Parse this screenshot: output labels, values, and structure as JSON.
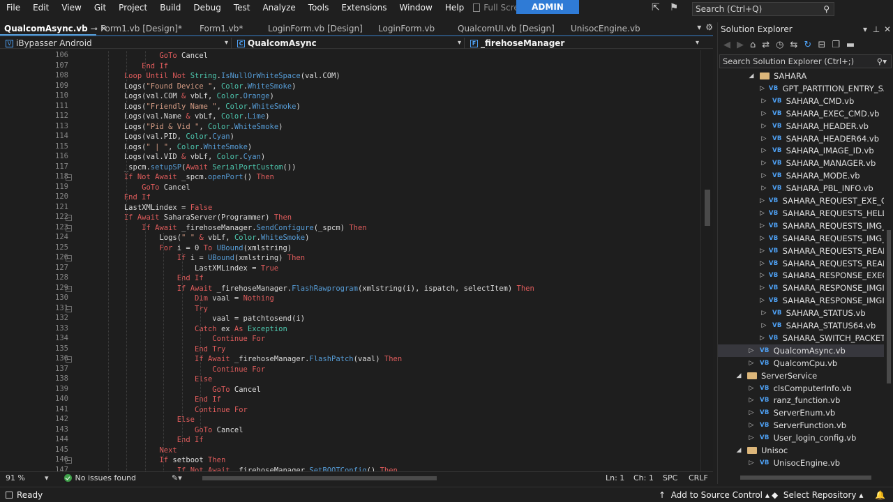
{
  "menu": [
    "File",
    "Edit",
    "View",
    "Git",
    "Project",
    "Build",
    "Debug",
    "Test",
    "Analyze",
    "Tools",
    "Extensions",
    "Window",
    "Help"
  ],
  "fullscreen_label": "Full Screen",
  "admin_label": "ADMIN",
  "search_placeholder": "Search (Ctrl+Q)",
  "tabs": [
    {
      "label": "QualcomAsync.vb",
      "active": true
    },
    {
      "label": "Form1.vb [Design]*"
    },
    {
      "label": "Form1.vb*"
    },
    {
      "label": "LoginForm.vb [Design]"
    },
    {
      "label": "LoginForm.vb"
    },
    {
      "label": "QualcomUI.vb [Design]"
    },
    {
      "label": "UnisocEngine.vb"
    }
  ],
  "nav": {
    "project": "iBypasser Android",
    "class": "QualcomAsync",
    "member": "_firehoseManager"
  },
  "code": {
    "first_line": 106,
    "lines": [
      "                    GoTo Cancel",
      "                End If",
      "            Loop Until Not String.IsNullOrWhiteSpace(val.COM)",
      "            Logs(\"Found Device \", Color.WhiteSmoke)",
      "            Logs(val.COM & vbLf, Color.Orange)",
      "            Logs(\"Friendly Name \", Color.WhiteSmoke)",
      "            Logs(val.Name & vbLf, Color.Lime)",
      "            Logs(\"Pid & Vid \", Color.WhiteSmoke)",
      "            Logs(val.PID, Color.Cyan)",
      "            Logs(\" | \", Color.WhiteSmoke)",
      "            Logs(val.VID & vbLf, Color.Cyan)",
      "            _spcm.setupSP(Await SerialPortCustom())",
      "            If Not Await _spcm.openPort() Then",
      "                GoTo Cancel",
      "            End If",
      "            LastXMLindex = False",
      "            If Await SaharaServer(Programmer) Then",
      "                If Await _firehoseManager.SendConfigure(_spcm) Then",
      "                    Logs(\" \" & vbLf, Color.WhiteSmoke)",
      "                    For i = 0 To UBound(xmlstring)",
      "                        If i = UBound(xmlstring) Then",
      "                            LastXMLindex = True",
      "                        End If",
      "                        If Await _firehoseManager.FlashRawprogram(xmlstring(i), ispatch, selectItem) Then",
      "                            Dim vaal = Nothing",
      "                            Try",
      "                                vaal = patchtosend(i)",
      "                            Catch ex As Exception",
      "                                Continue For",
      "                            End Try",
      "                            If Await _firehoseManager.FlashPatch(vaal) Then",
      "                                Continue For",
      "                            Else",
      "                                GoTo Cancel",
      "                            End If",
      "                            Continue For",
      "                        Else",
      "                            GoTo Cancel",
      "                        End If",
      "                    Next",
      "                    If setboot Then",
      "                        If Not Await _firehoseManager.SetBOOTConfig() Then"
    ]
  },
  "editor_status": {
    "zoom": "91 %",
    "issues": "No issues found",
    "line": "Ln: 1",
    "col": "Ch: 1",
    "spc": "SPC",
    "crlf": "CRLF"
  },
  "solution_explorer": {
    "title": "Solution Explorer",
    "search_placeholder": "Search Solution Explorer (Ctrl+;)",
    "items": [
      {
        "label": "SAHARA",
        "type": "folder",
        "level": 2,
        "expanded": true
      },
      {
        "label": "GPT_PARTITION_ENTRY_SA",
        "type": "vb",
        "level": 3
      },
      {
        "label": "SAHARA_CMD.vb",
        "type": "vb",
        "level": 3
      },
      {
        "label": "SAHARA_EXEC_CMD.vb",
        "type": "vb",
        "level": 3
      },
      {
        "label": "SAHARA_HEADER.vb",
        "type": "vb",
        "level": 3
      },
      {
        "label": "SAHARA_HEADER64.vb",
        "type": "vb",
        "level": 3
      },
      {
        "label": "SAHARA_IMAGE_ID.vb",
        "type": "vb",
        "level": 3
      },
      {
        "label": "SAHARA_MANAGER.vb",
        "type": "vb",
        "level": 3
      },
      {
        "label": "SAHARA_MODE.vb",
        "type": "vb",
        "level": 3
      },
      {
        "label": "SAHARA_PBL_INFO.vb",
        "type": "vb",
        "level": 3
      },
      {
        "label": "SAHARA_REQUEST_EXE_CI",
        "type": "vb",
        "level": 3
      },
      {
        "label": "SAHARA_REQUESTS_HELL",
        "type": "vb",
        "level": 3
      },
      {
        "label": "SAHARA_REQUESTS_IMG_",
        "type": "vb",
        "level": 3
      },
      {
        "label": "SAHARA_REQUESTS_IMG_",
        "type": "vb",
        "level": 3
      },
      {
        "label": "SAHARA_REQUESTS_READ",
        "type": "vb",
        "level": 3
      },
      {
        "label": "SAHARA_REQUESTS_READ",
        "type": "vb",
        "level": 3
      },
      {
        "label": "SAHARA_RESPONSE_EXEC",
        "type": "vb",
        "level": 3
      },
      {
        "label": "SAHARA_RESPONSE_IMGI",
        "type": "vb",
        "level": 3
      },
      {
        "label": "SAHARA_RESPONSE_IMGI",
        "type": "vb",
        "level": 3
      },
      {
        "label": "SAHARA_STATUS.vb",
        "type": "vb",
        "level": 3
      },
      {
        "label": "SAHARA_STATUS64.vb",
        "type": "vb",
        "level": 3
      },
      {
        "label": "SAHARA_SWITCH_PACKET",
        "type": "vb",
        "level": 3
      },
      {
        "label": "QualcomAsync.vb",
        "type": "vb",
        "level": 2,
        "selected": true
      },
      {
        "label": "QualcomCpu.vb",
        "type": "vb",
        "level": 2
      },
      {
        "label": "ServerService",
        "type": "folder",
        "level": 1,
        "expanded": true
      },
      {
        "label": "clsComputerInfo.vb",
        "type": "vb",
        "level": 2
      },
      {
        "label": "ranz_function.vb",
        "type": "vb",
        "level": 2
      },
      {
        "label": "ServerEnum.vb",
        "type": "vb",
        "level": 2
      },
      {
        "label": "ServerFunction.vb",
        "type": "vb",
        "level": 2
      },
      {
        "label": "User_login_config.vb",
        "type": "vb",
        "level": 2
      },
      {
        "label": "Unisoc",
        "type": "folder",
        "level": 1,
        "expanded": true
      },
      {
        "label": "UnisocEngine.vb",
        "type": "vb",
        "level": 2
      }
    ]
  },
  "statusbar": {
    "ready": "Ready",
    "add_source": "Add to Source Control",
    "select_repo": "Select Repository"
  },
  "colors": {
    "accent": "#2f7bd6",
    "keyword": "#e05c5c",
    "string": "#d69d85",
    "type": "#4ec9b0",
    "member": "#569cd6"
  }
}
